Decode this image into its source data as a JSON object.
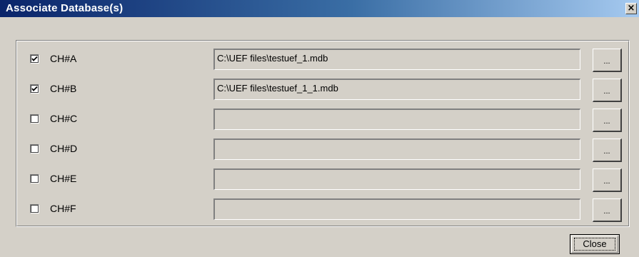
{
  "window": {
    "title": "Associate Database(s)",
    "close_glyph": "×"
  },
  "rows": [
    {
      "label": "CH#A",
      "checked": true,
      "path": "C:\\UEF files\\testuef_1.mdb",
      "browse": "..."
    },
    {
      "label": "CH#B",
      "checked": true,
      "path": "C:\\UEF files\\testuef_1_1.mdb",
      "browse": "..."
    },
    {
      "label": "CH#C",
      "checked": false,
      "path": "",
      "browse": "..."
    },
    {
      "label": "CH#D",
      "checked": false,
      "path": "",
      "browse": "..."
    },
    {
      "label": "CH#E",
      "checked": false,
      "path": "",
      "browse": "..."
    },
    {
      "label": "CH#F",
      "checked": false,
      "path": "",
      "browse": "..."
    }
  ],
  "buttons": {
    "close_label": "Close"
  },
  "colors": {
    "title_start": "#0a246a",
    "title_end": "#a6caf0",
    "face": "#d4d0c8"
  },
  "icons": {
    "checkmark": "checkmark-icon",
    "close": "close-icon"
  }
}
